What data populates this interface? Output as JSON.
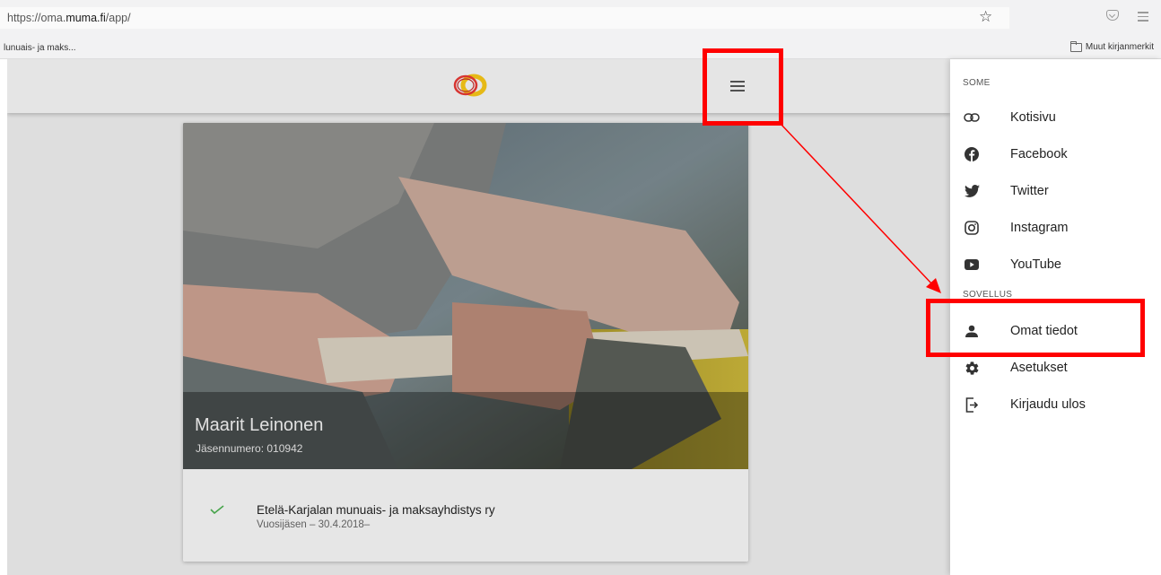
{
  "browser": {
    "url_prefix": "https://oma.",
    "url_domain": "muma.fi",
    "url_path": "/app/",
    "bookmark_left": "lunuais- ja maks...",
    "bookmark_right": "Muut kirjanmerkit"
  },
  "profile": {
    "name": "Maarit Leinonen",
    "member_number": "Jäsennumero: 010942"
  },
  "membership": {
    "organization": "Etelä-Karjalan munuais- ja maksayhdistys ry",
    "detail": "Vuosijäsen – 30.4.2018–"
  },
  "drawer": {
    "section_some": "SOME",
    "section_sovellus": "SOVELLUS",
    "some_items": [
      {
        "label": "Kotisivu",
        "icon": "link-icon"
      },
      {
        "label": "Facebook",
        "icon": "facebook-icon"
      },
      {
        "label": "Twitter",
        "icon": "twitter-icon"
      },
      {
        "label": "Instagram",
        "icon": "instagram-icon"
      },
      {
        "label": "YouTube",
        "icon": "youtube-icon"
      }
    ],
    "app_items": [
      {
        "label": "Omat tiedot",
        "icon": "person-icon"
      },
      {
        "label": "Asetukset",
        "icon": "gear-icon"
      },
      {
        "label": "Kirjaudu ulos",
        "icon": "logout-icon"
      }
    ]
  },
  "colors": {
    "annotation": "#ff0000",
    "check": "#4caf50",
    "logo_red": "#e53935",
    "logo_yellow": "#f5c518"
  }
}
